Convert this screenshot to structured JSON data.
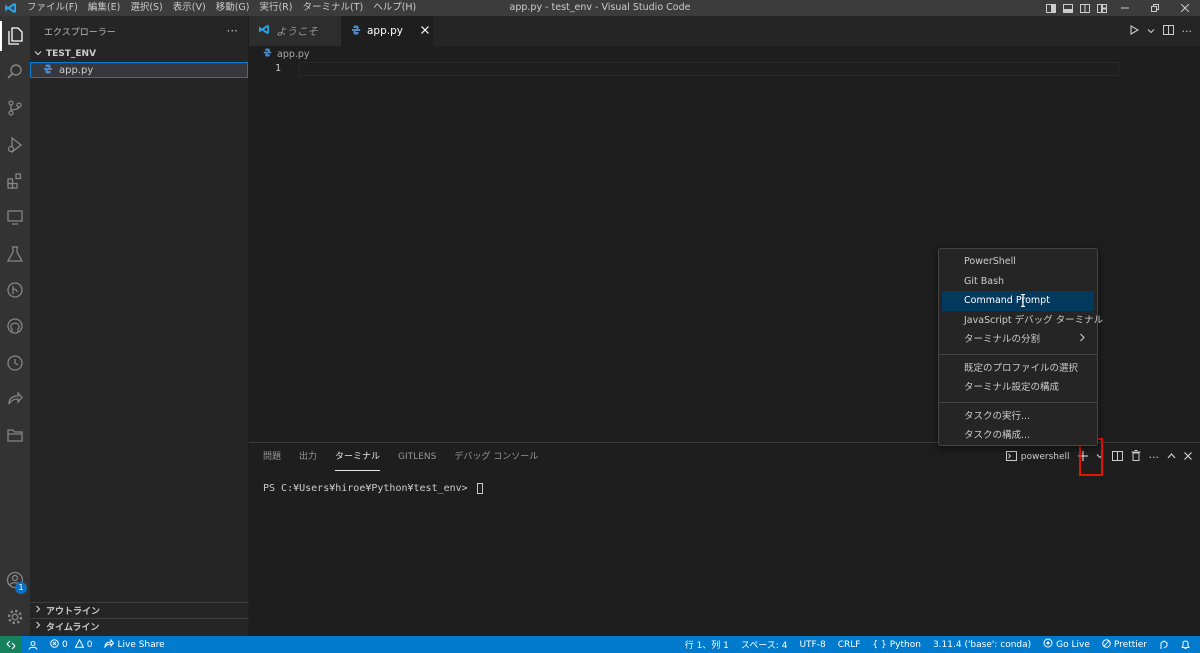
{
  "window": {
    "title": "app.py - test_env - Visual Studio Code",
    "menu": [
      "ファイル(F)",
      "編集(E)",
      "選択(S)",
      "表示(V)",
      "移動(G)",
      "実行(R)",
      "ターミナル(T)",
      "ヘルプ(H)"
    ]
  },
  "activity": {
    "accounts_badge": "1"
  },
  "sidebar": {
    "title": "エクスプローラー",
    "more": "···",
    "folder": "TEST_ENV",
    "file": "app.py",
    "outline": "アウトライン",
    "timeline": "タイムライン"
  },
  "tabs": [
    {
      "label": "ようこそ"
    },
    {
      "label": "app.py"
    }
  ],
  "breadcrumb": {
    "file": "app.py"
  },
  "editor": {
    "line_number": "1"
  },
  "panel": {
    "tabs": [
      "問題",
      "出力",
      "ターミナル",
      "GITLENS",
      "デバッグ コンソール"
    ],
    "shell": "powershell",
    "terminal_line": "PS C:¥Users¥hiroe¥Python¥test_env> "
  },
  "dropdown": {
    "group1": [
      "PowerShell",
      "Git Bash",
      "Command Prompt",
      "JavaScript デバッグ ターミナル",
      "ターミナルの分割"
    ],
    "group2": [
      "既定のプロファイルの選択",
      "ターミナル設定の構成"
    ],
    "group3": [
      "タスクの実行...",
      "タスクの構成..."
    ]
  },
  "statusbar": {
    "errors": "0",
    "warnings": "0",
    "liveshare": "Live Share",
    "position": "行 1、列 1",
    "spaces": "スペース: 4",
    "encoding": "UTF-8",
    "eol": "CRLF",
    "language": "Python",
    "interpreter": "3.11.4 ('base': conda)",
    "golive": "Go Live",
    "prettier": "Prettier"
  },
  "colors": {
    "statusbar": "#007acc",
    "remote": "#16825d",
    "selection": "#04395e",
    "highlight": "#e51400"
  }
}
